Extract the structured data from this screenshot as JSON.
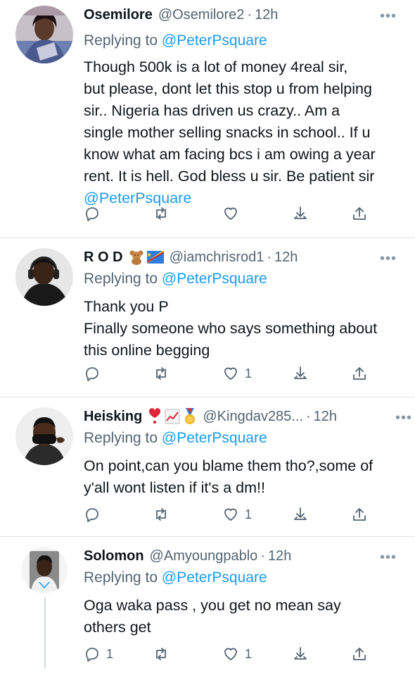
{
  "tweets": [
    {
      "name": "Osemilore",
      "handle": "@Osemilore2",
      "time": "12h",
      "reply_label": "Replying to",
      "reply_to": "@PeterPsquare",
      "text_lines": [
        "Though 500k is a lot of money 4real sir,",
        "but please, dont let this stop u from helping",
        "sir.. Nigeria has driven us crazy.. Am a",
        "single mother selling snacks in school.. If u",
        "know what am facing bcs i am owing a year",
        "rent. It is hell. God bless u sir. Be patient sir"
      ],
      "mention_line": "@PeterPsquare",
      "reply_count": "",
      "like_count": ""
    },
    {
      "name": "R O D",
      "handle": "@iamchrisrod1",
      "time": "12h",
      "reply_label": "Replying to",
      "reply_to": "@PeterPsquare",
      "text_lines": [
        "Thank you P",
        "Finally someone who says something about",
        "this online begging"
      ],
      "reply_count": "",
      "like_count": "1"
    },
    {
      "name": "Heisking",
      "handle": "@Kingdav285...",
      "time": "12h",
      "reply_label": "Replying to",
      "reply_to": "@PeterPsquare",
      "text_lines": [
        "On point,can you blame them tho?,some of",
        "y'all wont listen if it's a dm!!"
      ],
      "reply_count": "",
      "like_count": "1"
    },
    {
      "name": "Solomon",
      "handle": "@Amyoungpablo",
      "time": "12h",
      "reply_label": "Replying to",
      "reply_to": "@PeterPsquare",
      "text_lines": [
        "Oga waka pass , you get no mean say",
        "others get"
      ],
      "reply_count": "1",
      "like_count": "1"
    }
  ],
  "ui": {
    "dot": "·",
    "more": "•••"
  },
  "colors": {
    "link": "#1d9bf0",
    "secondary": "#536471",
    "divider": "#dfe3e6"
  }
}
